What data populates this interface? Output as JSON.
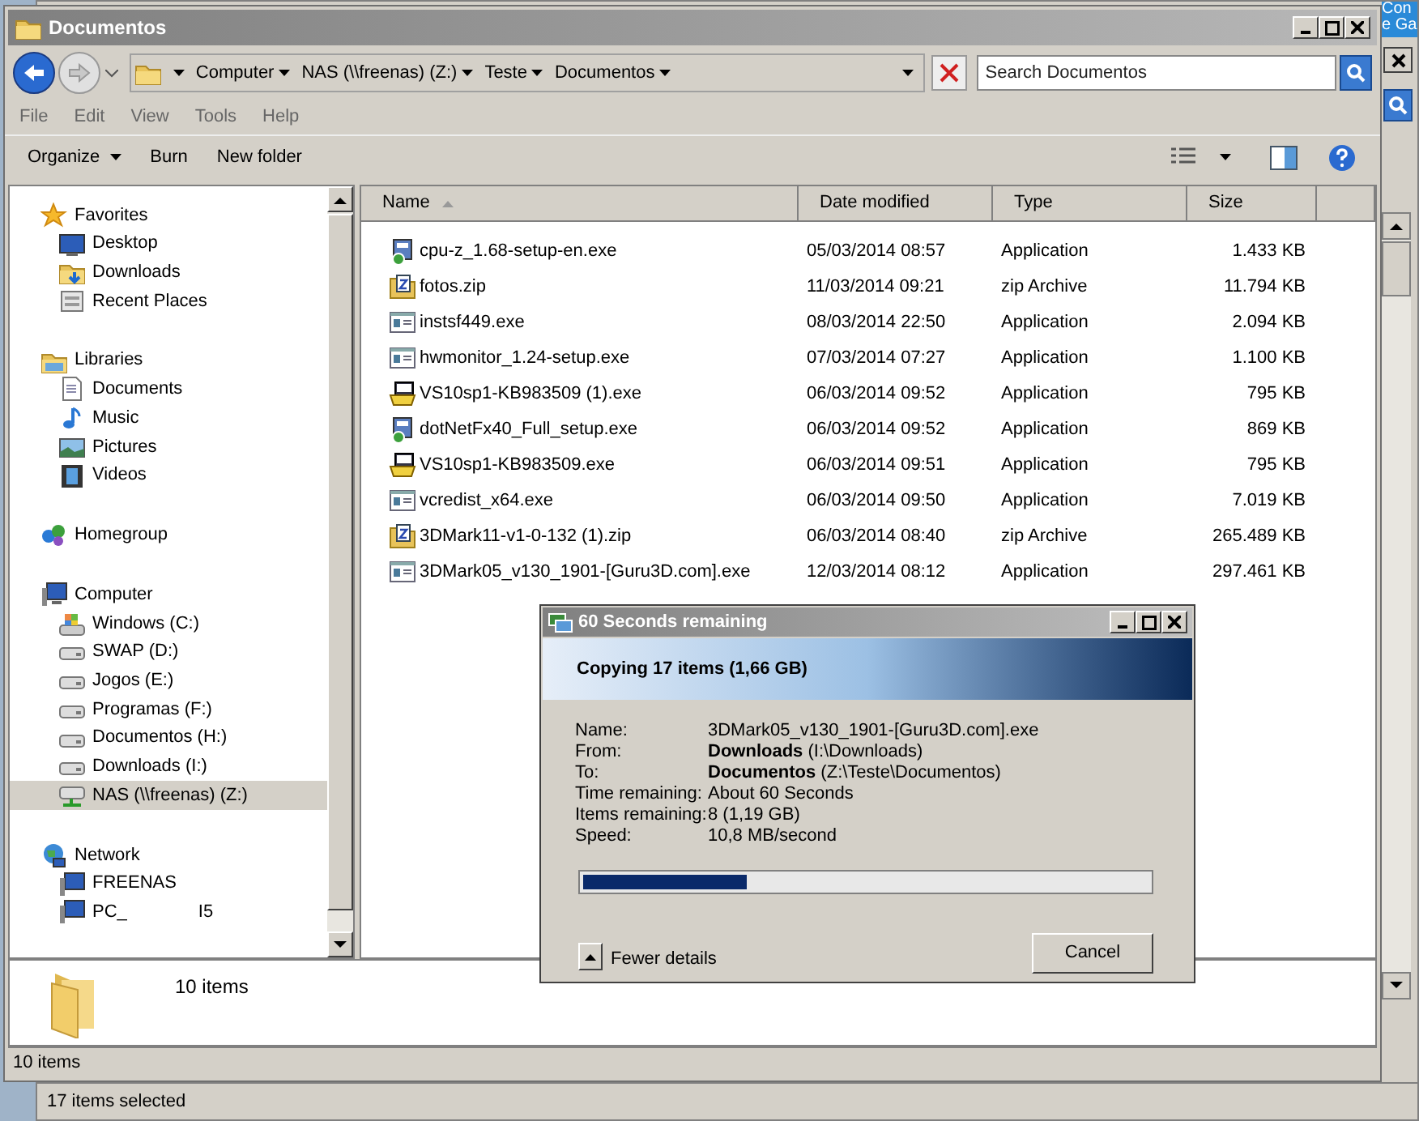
{
  "back_window": {
    "corner_text": [
      "Con",
      "e Ga"
    ],
    "status": "17 items selected"
  },
  "window": {
    "title": "Documentos"
  },
  "address": {
    "crumbs": [
      "Computer",
      "NAS (\\\\freenas) (Z:)",
      "Teste",
      "Documentos"
    ],
    "search_placeholder": "Search Documentos"
  },
  "menu": [
    "File",
    "Edit",
    "View",
    "Tools",
    "Help"
  ],
  "toolbar": [
    {
      "label": "Organize",
      "dropdown": true
    },
    {
      "label": "Burn",
      "dropdown": false
    },
    {
      "label": "New folder",
      "dropdown": false
    }
  ],
  "nav": [
    {
      "label": "Favorites",
      "kind": "star",
      "selected": false,
      "children": [
        {
          "label": "Desktop",
          "kind": "desktop",
          "selected": false
        },
        {
          "label": "Downloads",
          "kind": "downloads",
          "selected": false
        },
        {
          "label": "Recent Places",
          "kind": "recent",
          "selected": false
        }
      ]
    },
    {
      "label": "Libraries",
      "kind": "libraries",
      "selected": false,
      "children": [
        {
          "label": "Documents",
          "kind": "document",
          "selected": false
        },
        {
          "label": "Music",
          "kind": "music",
          "selected": false
        },
        {
          "label": "Pictures",
          "kind": "pictures",
          "selected": false
        },
        {
          "label": "Videos",
          "kind": "videos",
          "selected": false
        }
      ]
    },
    {
      "label": "Homegroup",
      "kind": "homegroup",
      "selected": false
    },
    {
      "label": "Computer",
      "kind": "computer",
      "selected": false,
      "children": [
        {
          "label": "Windows (C:)",
          "kind": "system-drive",
          "selected": false
        },
        {
          "label": "SWAP (D:)",
          "kind": "drive",
          "selected": false
        },
        {
          "label": "Jogos (E:)",
          "kind": "drive",
          "selected": false
        },
        {
          "label": "Programas (F:)",
          "kind": "drive",
          "selected": false
        },
        {
          "label": "Documentos (H:)",
          "kind": "drive",
          "selected": false
        },
        {
          "label": "Downloads (I:)",
          "kind": "drive",
          "selected": false
        },
        {
          "label": "NAS (\\\\freenas) (Z:)",
          "kind": "network-drive",
          "selected": true
        }
      ]
    },
    {
      "label": "Network",
      "kind": "network",
      "selected": false,
      "children": [
        {
          "label": "FREENAS",
          "kind": "pc",
          "selected": false
        },
        {
          "label": "PC_",
          "label_end": "I5",
          "kind": "pc",
          "selected": false
        }
      ]
    }
  ],
  "columns": [
    {
      "label": "Name",
      "sorted": true
    },
    {
      "label": "Date modified",
      "sorted": false
    },
    {
      "label": "Type",
      "sorted": false
    },
    {
      "label": "Size",
      "sorted": false
    }
  ],
  "rows": [
    {
      "name": "cpu-z_1.68-setup-en.exe",
      "kind": "setup",
      "date": "05/03/2014 08:57",
      "type": "Application",
      "size": "1.433 KB"
    },
    {
      "name": "fotos.zip",
      "kind": "zip",
      "date": "11/03/2014 09:21",
      "type": "zip Archive",
      "size": "11.794 KB"
    },
    {
      "name": "instsf449.exe",
      "kind": "app",
      "date": "08/03/2014 22:50",
      "type": "Application",
      "size": "2.094 KB"
    },
    {
      "name": "hwmonitor_1.24-setup.exe",
      "kind": "app",
      "date": "07/03/2014 07:27",
      "type": "Application",
      "size": "1.100 KB"
    },
    {
      "name": "VS10sp1-KB983509 (1).exe",
      "kind": "installer",
      "date": "06/03/2014 09:52",
      "type": "Application",
      "size": "795 KB"
    },
    {
      "name": "dotNetFx40_Full_setup.exe",
      "kind": "setup",
      "date": "06/03/2014 09:52",
      "type": "Application",
      "size": "869 KB"
    },
    {
      "name": "VS10sp1-KB983509.exe",
      "kind": "installer",
      "date": "06/03/2014 09:51",
      "type": "Application",
      "size": "795 KB"
    },
    {
      "name": "vcredist_x64.exe",
      "kind": "app",
      "date": "06/03/2014 09:50",
      "type": "Application",
      "size": "7.019 KB"
    },
    {
      "name": "3DMark11-v1-0-132 (1).zip",
      "kind": "zip",
      "date": "06/03/2014 08:40",
      "type": "zip Archive",
      "size": "265.489 KB"
    },
    {
      "name": "3DMark05_v130_1901-[Guru3D.com].exe",
      "kind": "app",
      "date": "12/03/2014 08:12",
      "type": "Application",
      "size": "297.461 KB"
    }
  ],
  "details_pane": {
    "text": "10 items"
  },
  "status_bar": "10 items",
  "dialog": {
    "title": "60 Seconds remaining",
    "heading": "Copying 17 items (1,66 GB)",
    "fields": [
      {
        "label": "Name:",
        "value": "3DMark05_v130_1901-[Guru3D.com].exe"
      },
      {
        "label": "From:",
        "value": "**Downloads** (I:\\Downloads)"
      },
      {
        "label": "To:",
        "value": "**Documentos** (Z:\\Teste\\Documentos)"
      },
      {
        "label": "Time remaining:",
        "value": "About 60 Seconds"
      },
      {
        "label": "Items remaining:",
        "value": "8 (1,19 GB)"
      },
      {
        "label": "Speed:",
        "value": "10,8 MB/second"
      }
    ],
    "progress": {
      "level": 0.29
    },
    "details_toggle": "Fewer details",
    "cancel": "Cancel"
  }
}
